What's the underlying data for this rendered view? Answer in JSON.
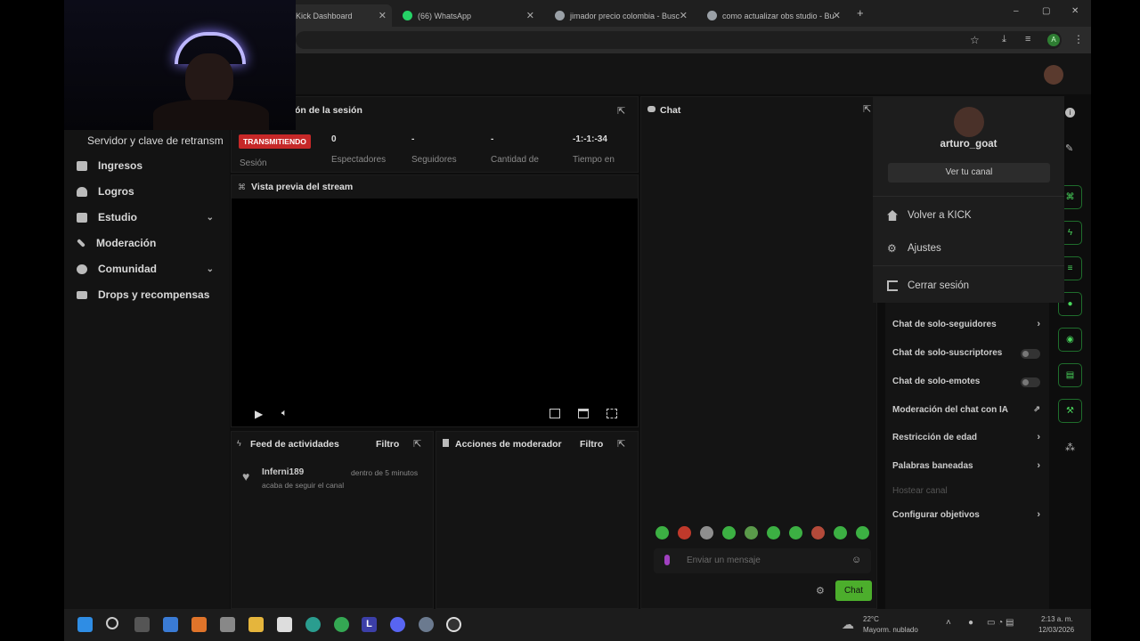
{
  "browser": {
    "tabs": [
      {
        "label": "Kick Dashboard",
        "active": true
      },
      {
        "label": "(66) WhatsApp",
        "active": false
      },
      {
        "label": "jimador precio colombia - Busc",
        "active": false
      },
      {
        "label": "como actualizar obs studio - Bu",
        "active": false
      }
    ],
    "new_tab": "+",
    "window_controls": [
      "–",
      "▢",
      "✕"
    ],
    "profile_initial": "A"
  },
  "sidebar": {
    "stream_key_label": "Servidor y clave de retransm",
    "items": [
      {
        "label": "Ingresos",
        "icon": "chart-icon",
        "expandable": false
      },
      {
        "label": "Logros",
        "icon": "trophy-icon",
        "expandable": false
      },
      {
        "label": "Estudio",
        "icon": "studio-icon",
        "expandable": true
      },
      {
        "label": "Moderación",
        "icon": "wrench-icon",
        "expandable": false
      },
      {
        "label": "Comunidad",
        "icon": "users-icon",
        "expandable": true
      },
      {
        "label": "Drops y recompensas",
        "icon": "drops-icon",
        "expandable": false
      }
    ]
  },
  "session": {
    "title": "ón de la sesión",
    "status_badge": "TRANSMITIENDO",
    "session_label": "Sesión",
    "stats": [
      {
        "value": "0",
        "label": "Espectadores"
      },
      {
        "value": "-",
        "label": "Seguidores"
      },
      {
        "value": "-",
        "label": "Cantidad de"
      },
      {
        "value": "-1:-1:-34",
        "label": "Tiempo en"
      }
    ]
  },
  "preview": {
    "title": "Vista previa del stream"
  },
  "feed": {
    "title": "Feed de actividades",
    "filter": "Filtro",
    "items": [
      {
        "user": "Inferni189",
        "time": "dentro de 5 minutos",
        "action": "acaba de seguir el canal"
      }
    ]
  },
  "mod_actions": {
    "title": "Acciones de moderador",
    "filter": "Filtro"
  },
  "chat": {
    "title": "Chat",
    "input_placeholder": "Enviar un mensaje",
    "send_button": "Chat"
  },
  "profile_menu": {
    "username": "arturo_goat",
    "view_channel": "Ver tu canal",
    "items": [
      {
        "label": "Volver a KICK",
        "icon": "home-icon"
      },
      {
        "label": "Ajustes",
        "icon": "gear-icon"
      },
      {
        "label": "Cerrar sesión",
        "icon": "logout-icon"
      }
    ]
  },
  "mod_settings": {
    "items": [
      {
        "label": "Chat de solo-seguidores",
        "control": "chevron"
      },
      {
        "label": "Chat de solo-suscriptores",
        "control": "toggle"
      },
      {
        "label": "Chat de solo-emotes",
        "control": "toggle"
      },
      {
        "label": "Moderación del chat con IA",
        "control": "external"
      },
      {
        "label": "Restricción de edad",
        "control": "chevron"
      },
      {
        "label": "Palabras baneadas",
        "control": "chevron"
      },
      {
        "label": "Hostear canal",
        "control": "disabled"
      },
      {
        "label": "Configurar objetivos",
        "control": "chevron"
      }
    ]
  },
  "taskbar": {
    "weather_temp": "22°C",
    "weather_desc": "Mayorm. nublado",
    "time": "2:13 a. m.",
    "date": "12/03/2026"
  },
  "colors": {
    "accent_green": "#53fc18",
    "live_red": "#c62828",
    "bg": "#0d0d0d"
  }
}
